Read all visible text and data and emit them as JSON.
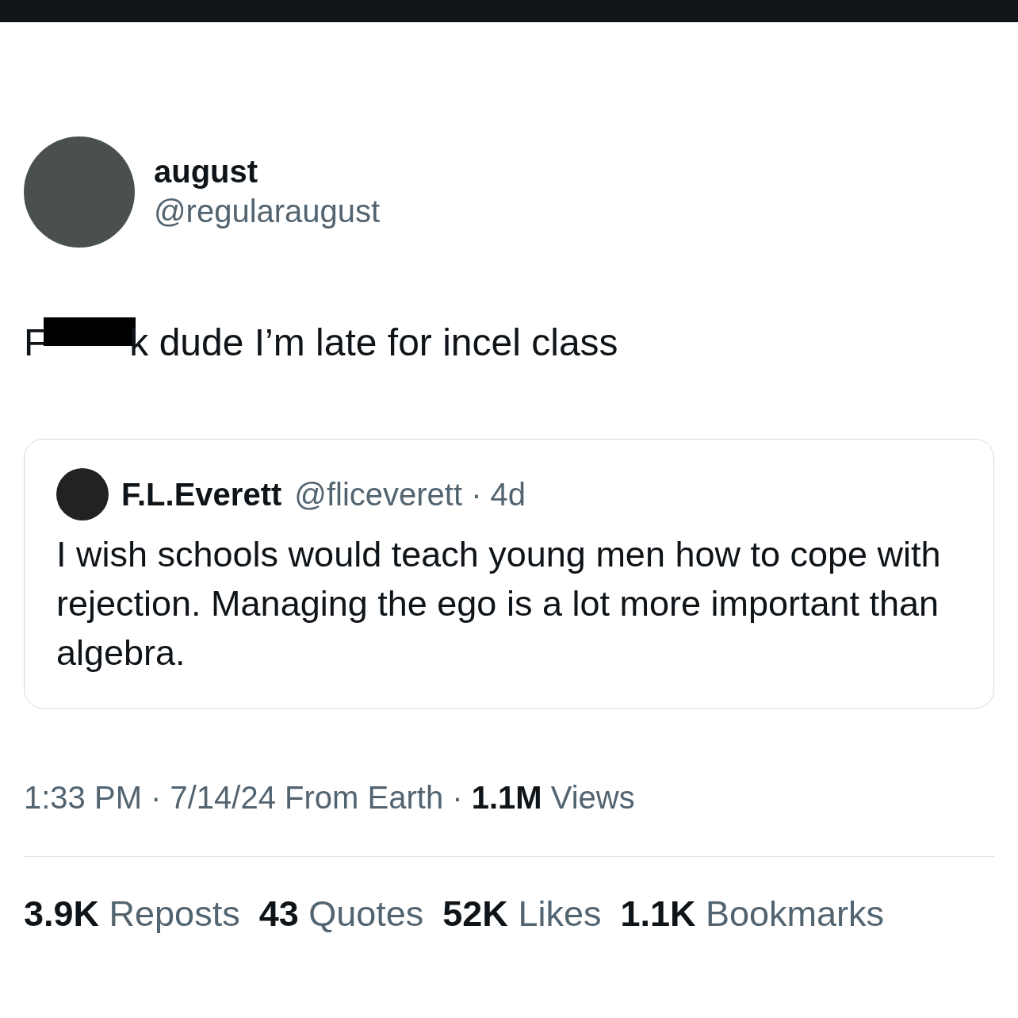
{
  "author": {
    "name": "august",
    "handle": "@regularaugust"
  },
  "tweet": {
    "before": "F",
    "redacted": true,
    "after": "k dude I’m late for incel class"
  },
  "quote": {
    "name": "F.L.Everett",
    "handle_age": "@fliceverett · 4d",
    "text": "I wish schools would teach young men how to cope with rejection. Managing the ego is a lot more important than algebra."
  },
  "meta": "1:33 PM · 7/14/24 From Earth · **1.1M** Views",
  "stats": [
    {
      "count": "3.9K",
      "label": "Reposts"
    },
    {
      "count": "43",
      "label": "Quotes"
    },
    {
      "count": "52K",
      "label": "Likes"
    },
    {
      "count": "1.1K",
      "label": "Bookmarks"
    }
  ]
}
